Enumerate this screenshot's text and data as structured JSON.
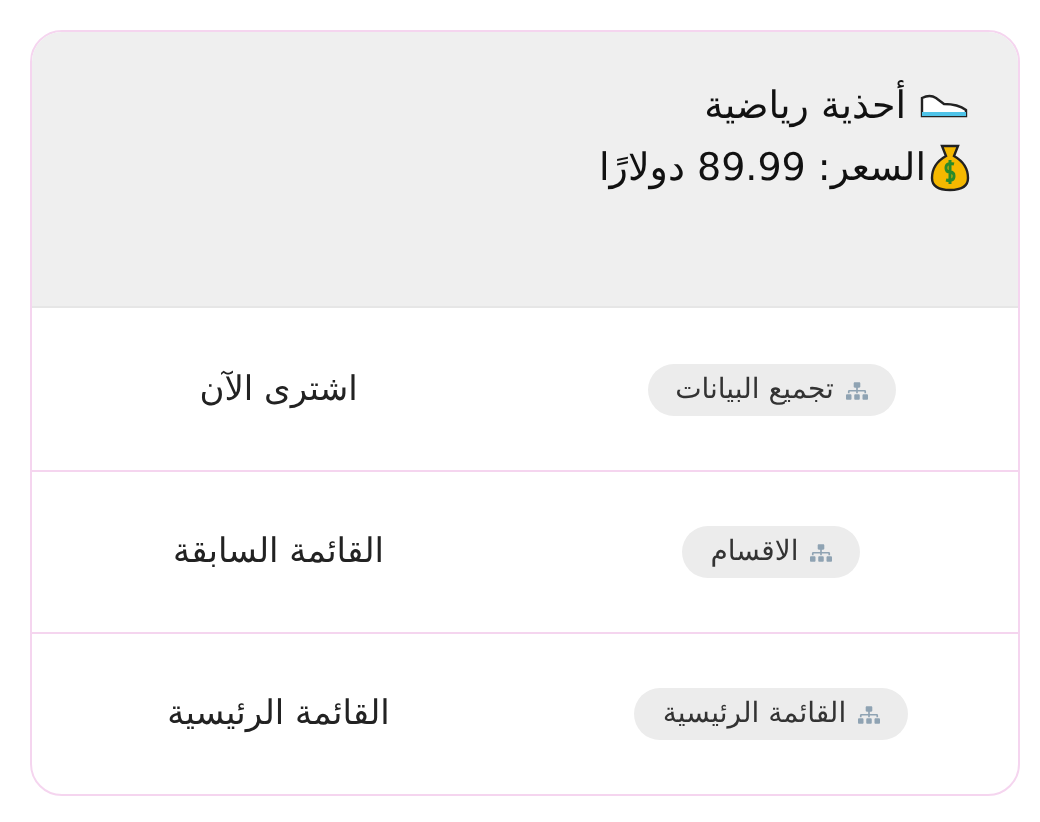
{
  "header": {
    "title": "أحذية رياضية",
    "price": "السعر: 89.99 دولارًا"
  },
  "rows": [
    {
      "tag": "تجميع البيانات",
      "action": "اشترى الآن"
    },
    {
      "tag": "الاقسام",
      "action": "القائمة السابقة"
    },
    {
      "tag": "القائمة الرئيسية",
      "action": "القائمة الرئيسية"
    }
  ]
}
